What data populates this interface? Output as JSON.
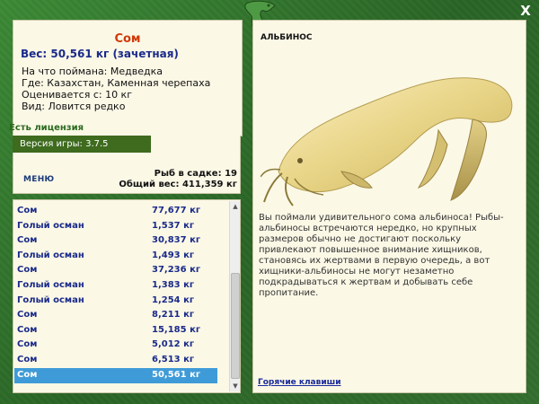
{
  "window": {
    "close_label": "X"
  },
  "fish_info": {
    "name": "Сом",
    "weight_line": "Вес: 50,561 кг (зачетная)",
    "caught_on": "На что поймана: Медведка",
    "location": "Где: Казахстан, Каменная черепаха",
    "valued_from": "Оценивается с: 10 кг",
    "type": "Вид: Ловится редко"
  },
  "license": "Есть лицензия",
  "version": "Версия игры: 3.7.5",
  "menu_label": "МЕНЮ",
  "stats": {
    "fish_in_cage": "Рыб в садке: 19",
    "total_weight": "Общий вес: 411,359 кг"
  },
  "catch_list": [
    {
      "name": "Сом",
      "weight": "77,677 кг"
    },
    {
      "name": "Голый осман",
      "weight": "1,537 кг"
    },
    {
      "name": "Сом",
      "weight": "30,837 кг"
    },
    {
      "name": "Голый осман",
      "weight": "1,493 кг"
    },
    {
      "name": "Сом",
      "weight": "37,236 кг"
    },
    {
      "name": "Голый осман",
      "weight": "1,383 кг"
    },
    {
      "name": "Голый осман",
      "weight": "1,254 кг"
    },
    {
      "name": "Сом",
      "weight": "8,211 кг"
    },
    {
      "name": "Сом",
      "weight": "15,185 кг"
    },
    {
      "name": "Сом",
      "weight": "5,012 кг"
    },
    {
      "name": "Сом",
      "weight": "6,513 кг"
    },
    {
      "name": "Сом",
      "weight": "50,561 кг",
      "selected": true
    }
  ],
  "detail_panel": {
    "title": "АЛЬБИНОС",
    "description": "Вы поймали удивительного сома альбиноса! Рыбы-альбиносы встречаются нередко, но крупных размеров обычно не достигают поскольку привлекают повышенное внимание хищников, становясь их жертвами в первую очередь, а вот хищники-альбиносы не могут незаметно подкрадываться к жертвам и добывать себе пропитание.",
    "hotkeys_link": "Горячие клавиши"
  },
  "colors": {
    "frame_green": "#2d6e2a",
    "panel_bg": "#fbf8e6",
    "title_red": "#d23a0a",
    "text_blue": "#1a2a8a",
    "selected_row": "#3f9bd8",
    "version_bar": "#3e6b1e"
  }
}
